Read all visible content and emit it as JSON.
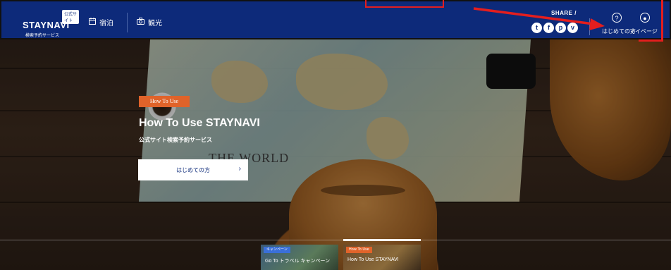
{
  "header": {
    "logo_main": "STAYNAVI",
    "logo_badge": "公式サイト",
    "logo_sub": "検索予約サービス",
    "nav": [
      {
        "label": "宿泊",
        "icon": "calendar-icon"
      },
      {
        "label": "観光",
        "icon": "camera-icon"
      }
    ],
    "share_label": "SHARE /",
    "social": [
      {
        "icon": "twitter-icon",
        "glyph": "t"
      },
      {
        "icon": "facebook-icon",
        "glyph": "f"
      },
      {
        "icon": "pinterest-icon",
        "glyph": "p"
      },
      {
        "icon": "pocket-icon",
        "glyph": "v"
      }
    ],
    "help_label": "はじめての方",
    "mypage_label": "マイページ"
  },
  "hero": {
    "tag": "How To Use",
    "title": "How To Use STAYNAVI",
    "subtitle": "公式サイト検索予約サービス",
    "button_label": "はじめての方",
    "button_chevron": "›",
    "map_text": "THE WORLD"
  },
  "thumbnails": [
    {
      "tag": "キャンペーン",
      "title": "Go To トラベル キャンペーン",
      "tag_color": "#3a6fd8",
      "active": false
    },
    {
      "tag": "How To Use",
      "title": "How To Use STAYNAVI",
      "tag_color": "#e0632a",
      "active": true
    }
  ],
  "colors": {
    "header_bg": "#0d2a7a",
    "accent_orange": "#e0632a",
    "annotation_red": "#e41e1e"
  }
}
